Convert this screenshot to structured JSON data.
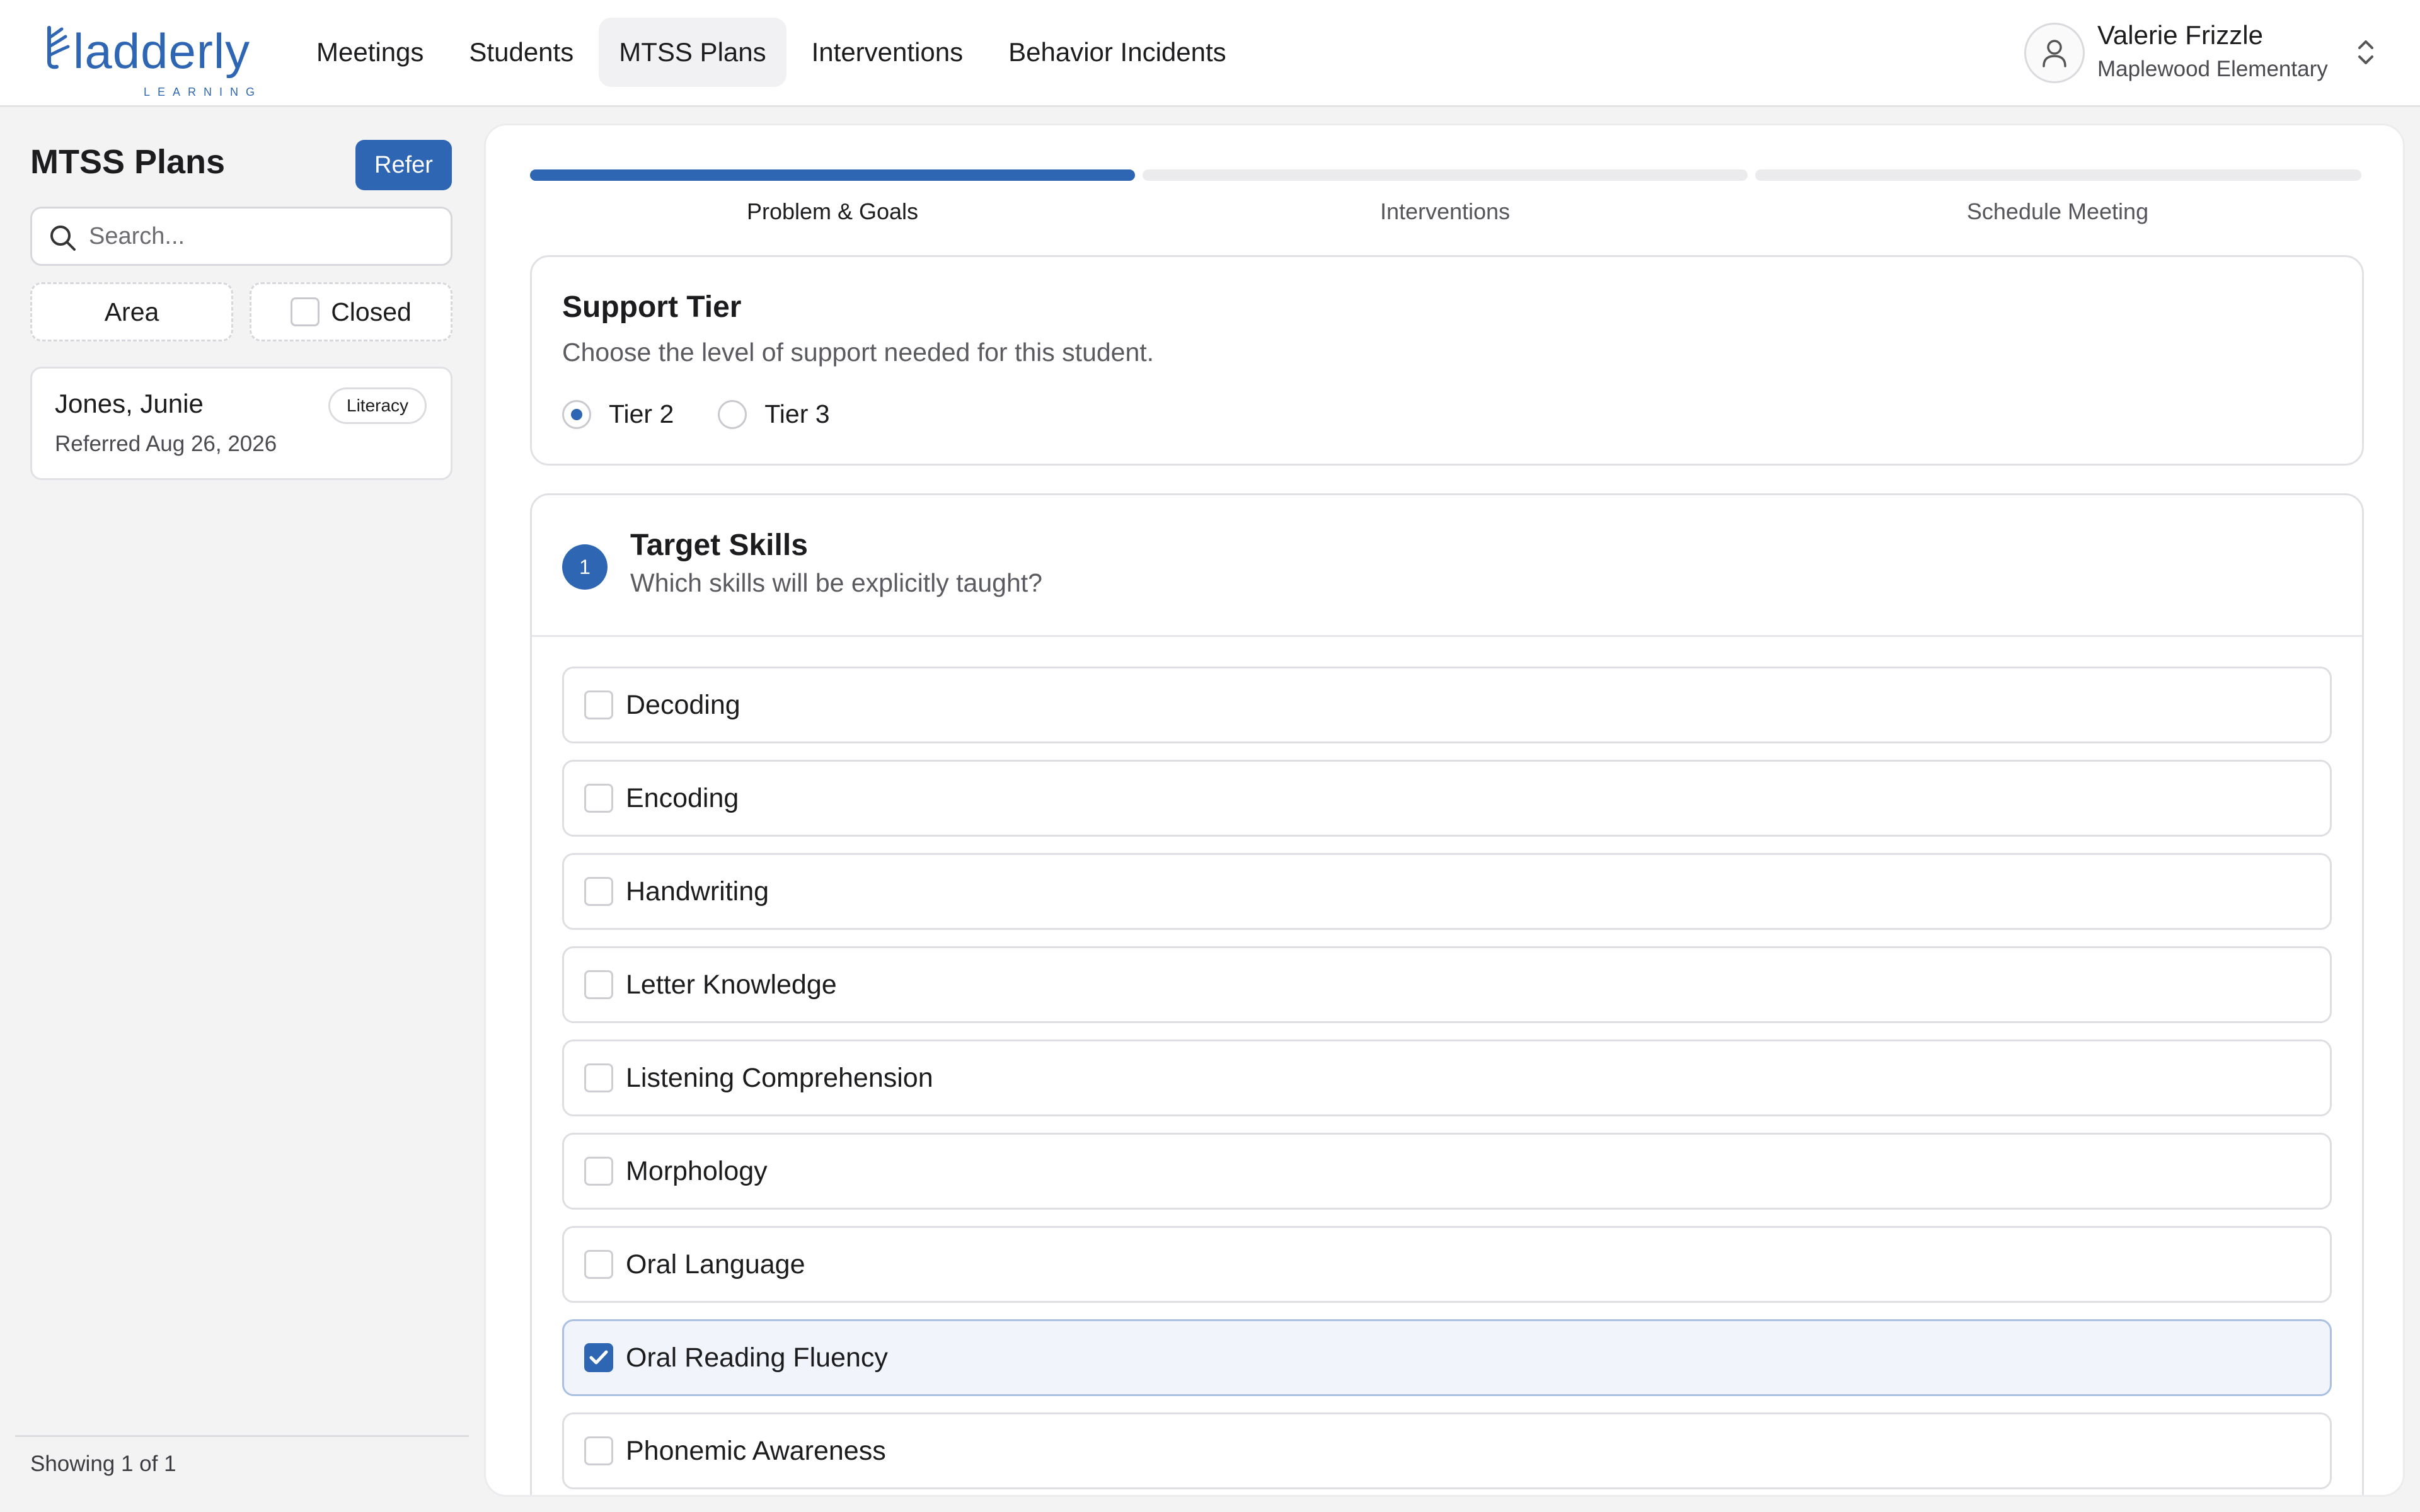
{
  "brand": {
    "name": "ladderly",
    "tagline": "LEARNING",
    "color": "#2e66b3"
  },
  "nav": {
    "items": [
      {
        "label": "Meetings"
      },
      {
        "label": "Students"
      },
      {
        "label": "MTSS Plans",
        "active": true
      },
      {
        "label": "Interventions"
      },
      {
        "label": "Behavior Incidents"
      }
    ]
  },
  "user": {
    "name": "Valerie Frizzle",
    "school": "Maplewood Elementary",
    "icon": "user-icon"
  },
  "sidebar": {
    "title": "MTSS Plans",
    "refer_label": "Refer",
    "search_placeholder": "Search...",
    "filters": {
      "area_label": "Area",
      "closed_label": "Closed",
      "closed_checked": false
    },
    "plans": [
      {
        "name": "Jones, Junie",
        "date": "Referred Aug 26, 2026",
        "badge": "Literacy"
      }
    ],
    "footer": "Showing 1 of 1"
  },
  "steps": {
    "items": [
      {
        "label": "Problem & Goals",
        "active": true
      },
      {
        "label": "Interventions",
        "active": false
      },
      {
        "label": "Schedule Meeting",
        "active": false
      }
    ],
    "progress_fraction": 0.333
  },
  "tier": {
    "title": "Support Tier",
    "description": "Choose the level of support needed for this student.",
    "options": [
      {
        "label": "Tier 2",
        "selected": true
      },
      {
        "label": "Tier 3",
        "selected": false
      }
    ]
  },
  "skills": {
    "step_number": "1",
    "title": "Target Skills",
    "description": "Which skills will be explicitly taught?",
    "items": [
      {
        "label": "Decoding",
        "checked": false
      },
      {
        "label": "Encoding",
        "checked": false
      },
      {
        "label": "Handwriting",
        "checked": false
      },
      {
        "label": "Letter Knowledge",
        "checked": false
      },
      {
        "label": "Listening Comprehension",
        "checked": false
      },
      {
        "label": "Morphology",
        "checked": false
      },
      {
        "label": "Oral Language",
        "checked": false
      },
      {
        "label": "Oral Reading Fluency",
        "checked": true
      },
      {
        "label": "Phonemic Awareness",
        "checked": false
      }
    ]
  }
}
